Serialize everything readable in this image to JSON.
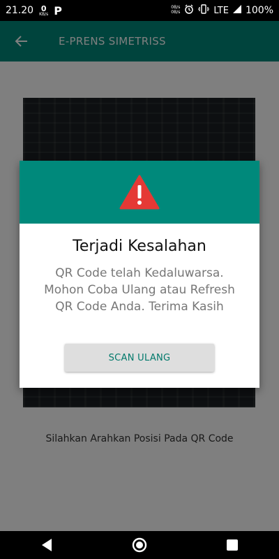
{
  "status_bar": {
    "time": "21.20",
    "speed_value": "0",
    "speed_unit": "KB/s",
    "app_indicator": "P",
    "dual_speed_top": "0B/s",
    "dual_speed_bottom": "0B/s",
    "alarm_icon": "alarm-icon",
    "vibrate_icon": "vibrate-icon",
    "network": "LTE",
    "battery": "100%"
  },
  "app_bar": {
    "title": "E-PRENS SIMETRISS",
    "back_icon": "arrow-back-icon",
    "color": "#00897b"
  },
  "content": {
    "hint": "Silahkan Arahkan Posisi Pada QR Code"
  },
  "dialog": {
    "icon": "warning-icon",
    "icon_color": "#e53935",
    "title": "Terjadi Kesalahan",
    "message": "QR Code telah Kedaluwarsa. Mohon Coba Ulang atau Refresh QR Code Anda. Terima Kasih",
    "button_label": "SCAN ULANG"
  },
  "nav_bar": {
    "back_icon": "nav-back-icon",
    "home_icon": "nav-home-icon",
    "recent_icon": "nav-recent-icon"
  }
}
